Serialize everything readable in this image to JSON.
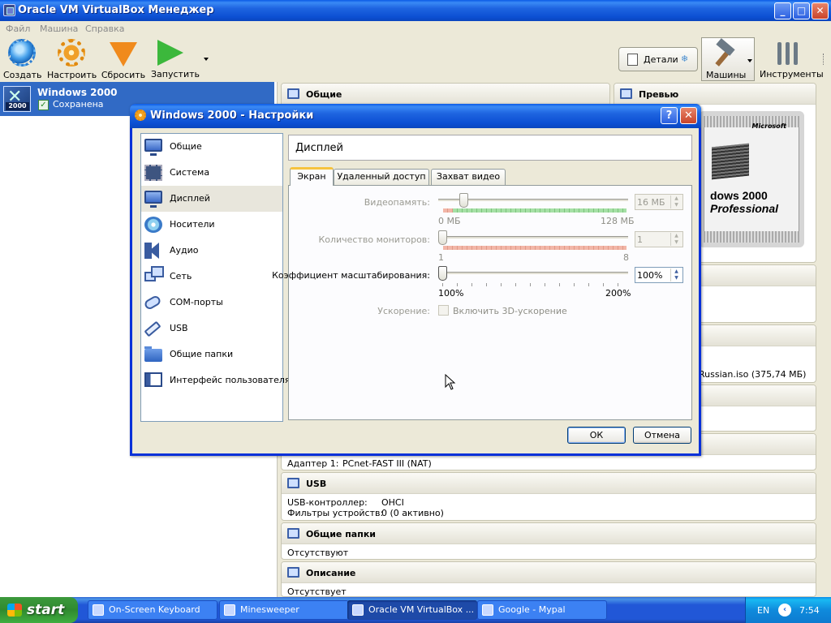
{
  "main_window": {
    "title": "Oracle VM VirtualBox Менеджер",
    "menu": [
      "Файл",
      "Машина",
      "Справка"
    ],
    "toolbar": {
      "create": "Создать",
      "settings": "Настроить",
      "discard": "Сбросить",
      "start": "Запустить",
      "details": "Детали",
      "machines": "Машины",
      "tools": "Инструменты"
    }
  },
  "vm_list": [
    {
      "name": "Windows 2000",
      "state": "Сохранена",
      "os_badge": "2000"
    }
  ],
  "details": {
    "general": {
      "title": "Общие"
    },
    "preview": {
      "title": "Превью",
      "brand": "Microsoft",
      "line1": "dows 2000",
      "line2": "Professional"
    },
    "storage_fragment": "Russian.iso (375,74 МБ)",
    "network_row": {
      "key": "Адаптер 1:",
      "value": "PCnet-FAST III (NAT)"
    },
    "usb": {
      "title": "USB",
      "rows": [
        {
          "key": "USB-контроллер:",
          "value": "OHCI"
        },
        {
          "key": "Фильтры устройств:",
          "value": "0 (0 активно)"
        }
      ]
    },
    "shared_folders": {
      "title": "Общие папки",
      "value": "Отсутствуют"
    },
    "description": {
      "title": "Описание",
      "value": "Отсутствует"
    }
  },
  "dialog": {
    "title": "Windows 2000 - Настройки",
    "categories": [
      {
        "label": "Общие",
        "icon": "monitor-icon"
      },
      {
        "label": "Система",
        "icon": "chip-icon"
      },
      {
        "label": "Дисплей",
        "icon": "display-icon",
        "selected": true
      },
      {
        "label": "Носители",
        "icon": "disk-icon"
      },
      {
        "label": "Аудио",
        "icon": "speaker-icon"
      },
      {
        "label": "Сеть",
        "icon": "network-icon"
      },
      {
        "label": "COM-порты",
        "icon": "serial-port-icon"
      },
      {
        "label": "USB",
        "icon": "usb-icon"
      },
      {
        "label": "Общие папки",
        "icon": "folder-icon"
      },
      {
        "label": "Интерфейс пользователя",
        "icon": "window-icon"
      }
    ],
    "page_title": "Дисплей",
    "tabs": [
      {
        "label": "Экран",
        "active": true
      },
      {
        "label": "Удаленный доступ",
        "active": false
      },
      {
        "label": "Захват видео",
        "active": false
      }
    ],
    "screen": {
      "video_memory": {
        "label": "Видеопамять:",
        "value": "16 МБ",
        "value_mb": 16,
        "min": "0 МБ",
        "max": "128 МБ",
        "enabled": false
      },
      "monitor_count": {
        "label": "Количество мониторов:",
        "value": "1",
        "count": 1,
        "min": "1",
        "max": "8",
        "enabled": false
      },
      "scale_factor": {
        "label": "Коэффициент масштабирования:",
        "value": "100%",
        "percent": 100,
        "min": "100%",
        "max": "200%",
        "enabled": true
      },
      "acceleration": {
        "label": "Ускорение:",
        "checkbox": "Включить 3D-ускорение",
        "checked": false,
        "enabled": false
      }
    },
    "buttons": {
      "ok": "ОК",
      "cancel": "Отмена"
    }
  },
  "taskbar": {
    "start": "start",
    "tasks": [
      {
        "label": "On-Screen Keyboard",
        "active": false
      },
      {
        "label": "Minesweeper",
        "active": false
      },
      {
        "label": "Oracle VM VirtualBox ...",
        "active": true
      },
      {
        "label": "Google - Mypal",
        "active": false
      }
    ],
    "lang": "EN",
    "clock": "7:54"
  }
}
